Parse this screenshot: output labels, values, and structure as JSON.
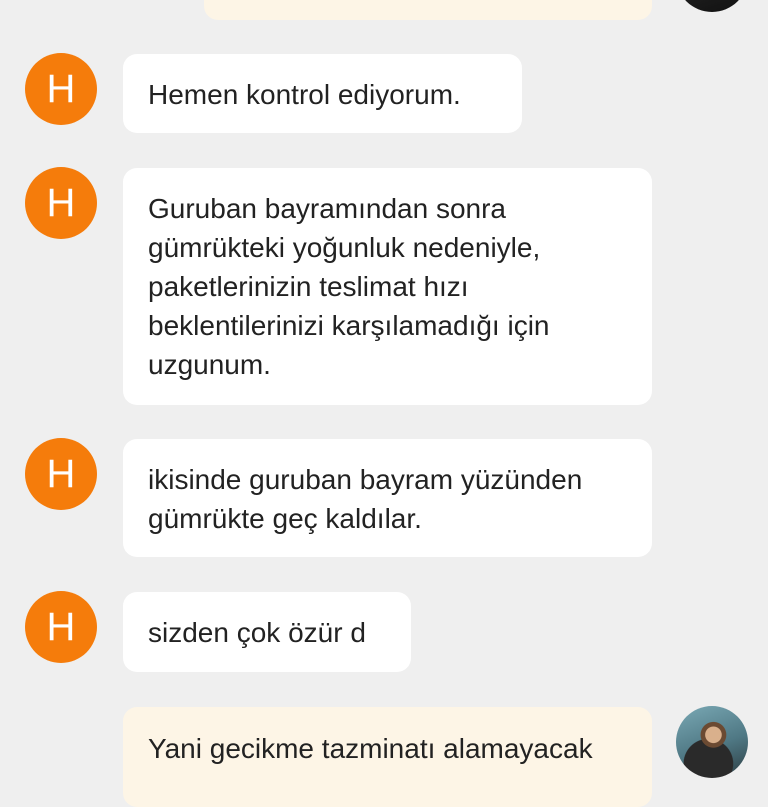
{
  "agent": {
    "avatar_letter": "H",
    "avatar_color": "#f57c0b"
  },
  "messages": [
    {
      "text": "Hemen kontrol ediyorum."
    },
    {
      "text": "Guruban bayramından sonra\ngümrükteki yoğunluk nedeniyle,\npaketlerinizin teslimat hızı\nbeklentilerinizi karşılamadığı için\nuzgunum."
    },
    {
      "text": "ikisinde guruban bayram yüzünden\ngümrükte geç kaldılar."
    },
    {
      "text": "sizden çok özür d"
    },
    {
      "text": "Yani gecikme tazminatı alamayacak"
    }
  ],
  "colors": {
    "background": "#efefef",
    "agent_bubble": "#ffffff",
    "user_bubble": "#fdf5e6"
  }
}
